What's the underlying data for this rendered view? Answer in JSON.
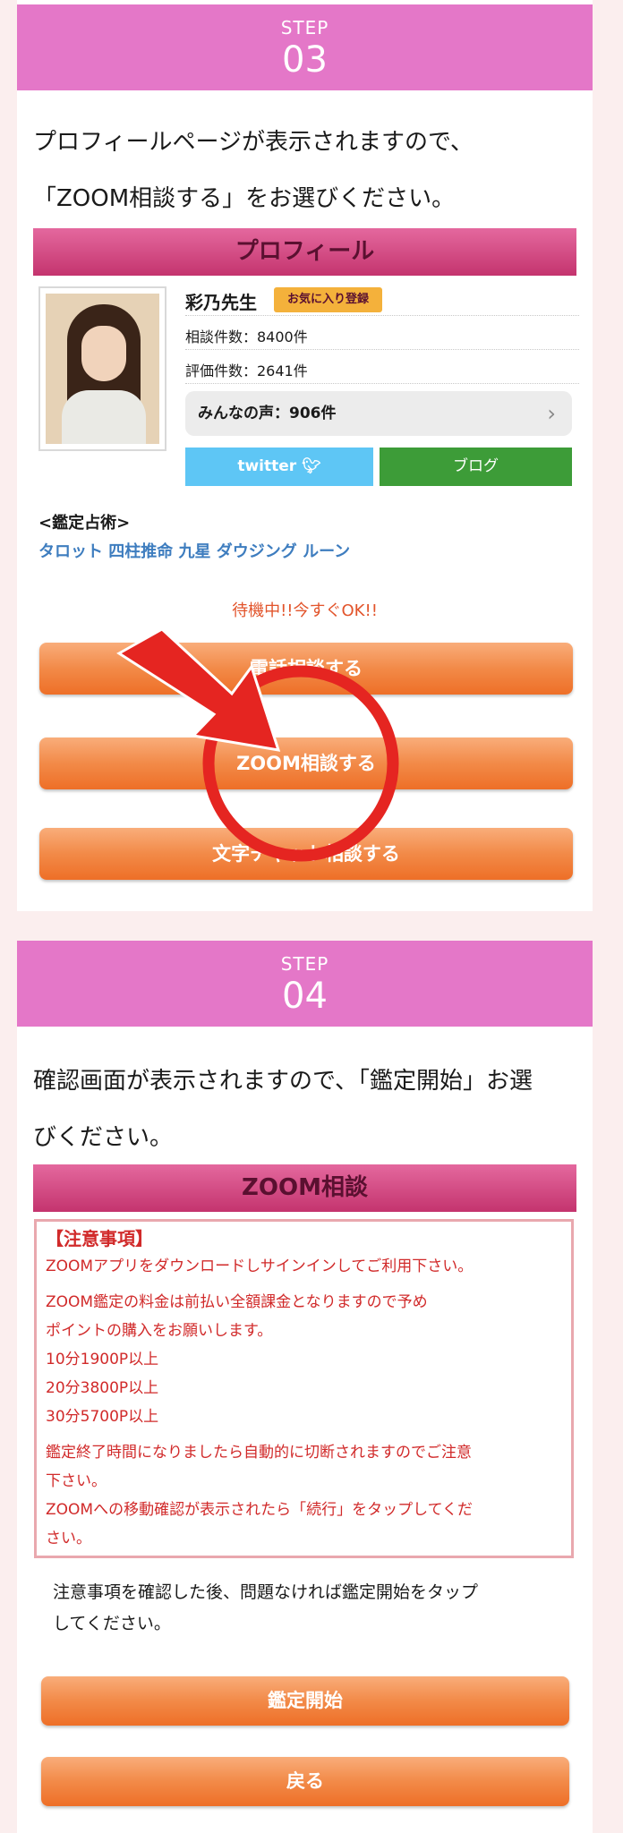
{
  "step3": {
    "label": "STEP",
    "number": "03",
    "intro_line1": "プロフィールページが表示されますので、",
    "intro_line2": "「ZOOM相談する」をお選びください。",
    "profile": {
      "header": "プロフィール",
      "name": "彩乃先生",
      "fav_badge": "お気に入り登録",
      "consult_count": "相談件数：8400件",
      "review_count": "評価件数：2641件",
      "voice": "みんなの声：906件",
      "twitter": "twitter",
      "blog": "ブログ",
      "method_title": "<鑑定占術>",
      "methods": "タロット 四柱推命 九星 ダウジング ルーン",
      "waiting": "待機中!!今すぐOK!!",
      "phone_button": "電話相談する",
      "zoom_button": "ZOOM相談する",
      "chat_button": "文字チャット相談する"
    },
    "colors": {
      "highlight": "#e52521"
    }
  },
  "step4": {
    "label": "STEP",
    "number": "04",
    "intro_line1": "確認画面が表示されますので、「鑑定開始」お選",
    "intro_line2": "びください。",
    "dialog": {
      "header": "ZOOM相談",
      "notice_title": "【注意事項】",
      "line1": "ZOOMアプリをダウンロードしサインインしてご利用下さい。",
      "line2a": "ZOOM鑑定の料金は前払い全額課金となりますので予め",
      "line2b": "ポイントの購入をお願いします。",
      "price1": "10分1900P以上",
      "price2": "20分3800P以上",
      "price3": "30分5700P以上",
      "line3a": "鑑定終了時間になりましたら自動的に切断されますのでご注意",
      "line3b": "下さい。",
      "line4a": "ZOOMへの移動確認が表示されたら「続行」をタップしてくだ",
      "line4b": "さい。",
      "confirm_line1": "注意事項を確認した後、問題なければ鑑定開始をタップ",
      "confirm_line2": "してください。",
      "start_button": "鑑定開始",
      "back_button": "戻る"
    }
  }
}
